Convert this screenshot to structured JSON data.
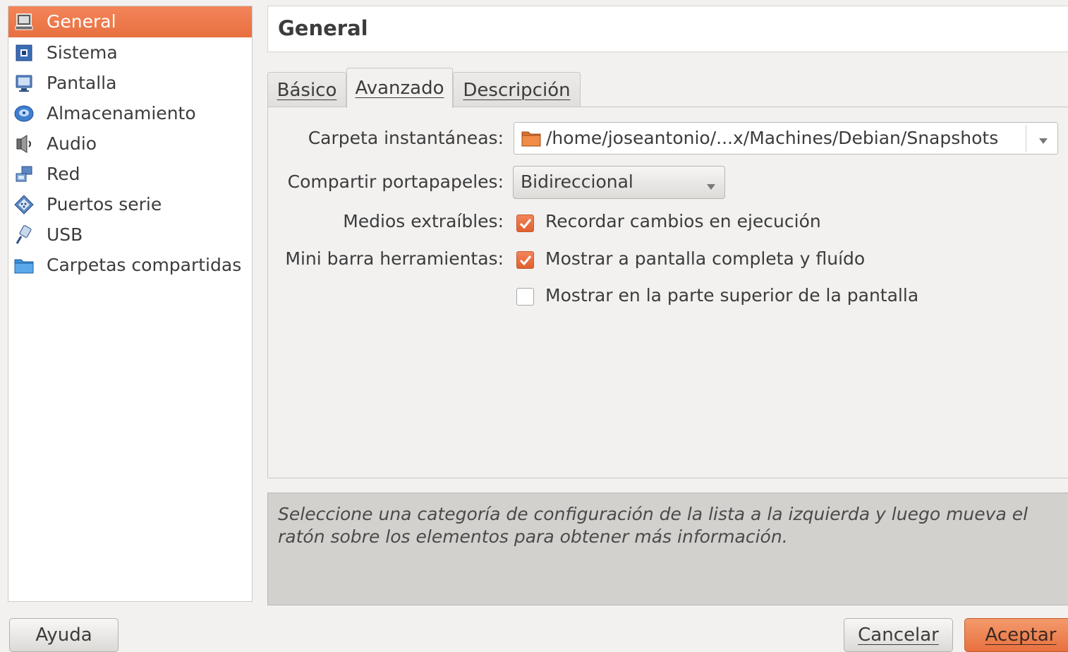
{
  "sidebar": {
    "items": [
      {
        "label": "General",
        "icon": "general-icon",
        "selected": true
      },
      {
        "label": "Sistema",
        "icon": "chip-icon"
      },
      {
        "label": "Pantalla",
        "icon": "monitor-icon"
      },
      {
        "label": "Almacenamiento",
        "icon": "disk-icon"
      },
      {
        "label": "Audio",
        "icon": "speaker-icon"
      },
      {
        "label": "Red",
        "icon": "network-icon"
      },
      {
        "label": "Puertos serie",
        "icon": "serial-port-icon"
      },
      {
        "label": "USB",
        "icon": "usb-icon"
      },
      {
        "label": "Carpetas compartidas",
        "icon": "folder-icon"
      }
    ]
  },
  "header": {
    "title": "General"
  },
  "tabs": [
    {
      "label": "Básico"
    },
    {
      "label": "Avanzado",
      "active": true
    },
    {
      "label": "Descripción"
    }
  ],
  "form": {
    "snapshot_label": "Carpeta instantáneas:",
    "snapshot_path": "/home/joseantonio/...x/Machines/Debian/Snapshots",
    "clipboard_label": "Compartir portapapeles:",
    "clipboard_value": "Bidireccional",
    "removable_label": "Medios extraíbles:",
    "removable_option": "Recordar cambios en ejecución",
    "minitoolbar_label": "Mini barra herramientas:",
    "minitoolbar_option1": "Mostrar a pantalla completa y fluído",
    "minitoolbar_option2": "Mostrar en la parte superior de la pantalla"
  },
  "info": {
    "text": "Seleccione una categoría de configuración de la lista a la izquierda y luego mueva el ratón sobre los elementos para obtener más información."
  },
  "buttons": {
    "help": "Ayuda",
    "cancel": "Cancelar",
    "accept": "Aceptar"
  },
  "colors": {
    "accent": "#e8703f",
    "background": "#f2f1f0"
  }
}
